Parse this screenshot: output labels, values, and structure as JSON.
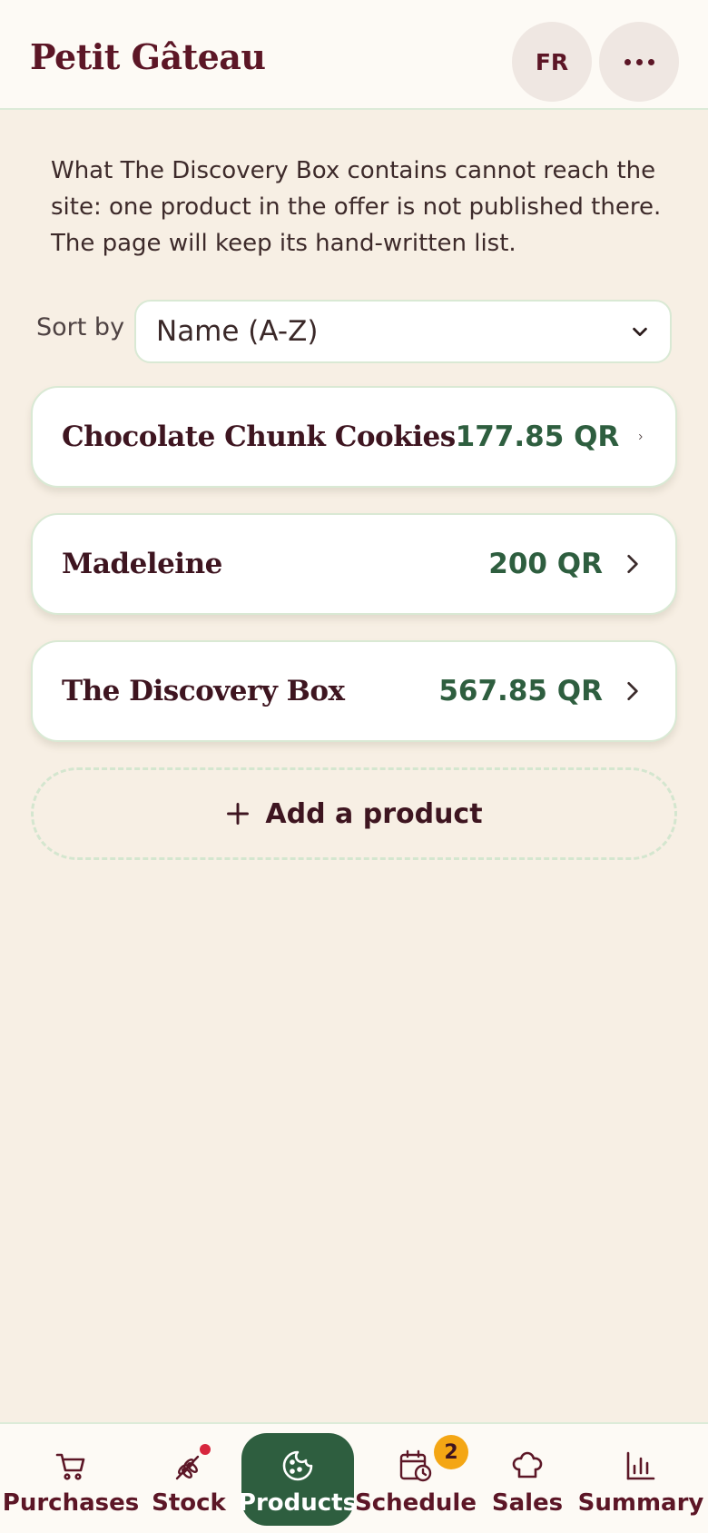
{
  "header": {
    "title": "Petit Gâteau",
    "language_label": "FR",
    "more_icon": "more-horizontal-icon"
  },
  "notice": {
    "text": "What The Discovery Box contains cannot reach the site: one product in the offer is not published there. The page will keep its hand-written list."
  },
  "sort": {
    "label": "Sort by",
    "selected": "Name (A-Z)"
  },
  "products": [
    {
      "name": "Chocolate Chunk Cookies",
      "price": "177.85 QR"
    },
    {
      "name": "Madeleine",
      "price": "200 QR"
    },
    {
      "name": "The Discovery Box",
      "price": "567.85 QR"
    }
  ],
  "add_product": {
    "label": "Add a product"
  },
  "nav": {
    "items": [
      {
        "label": "Purchases",
        "icon": "cart-icon"
      },
      {
        "label": "Stock",
        "icon": "wheat-icon"
      },
      {
        "label": "Products",
        "icon": "cookie-icon"
      },
      {
        "label": "Schedule",
        "icon": "calendar-clock-icon",
        "badge": "2"
      },
      {
        "label": "Sales",
        "icon": "chef-hat-icon"
      },
      {
        "label": "Summary",
        "icon": "bar-chart-icon"
      }
    ],
    "active": "Products"
  },
  "colors": {
    "brand": "#5c1626",
    "accent": "#2e5e3f",
    "background": "#f7efe4",
    "badge": "#f4a614",
    "alert_dot": "#d7263d"
  }
}
